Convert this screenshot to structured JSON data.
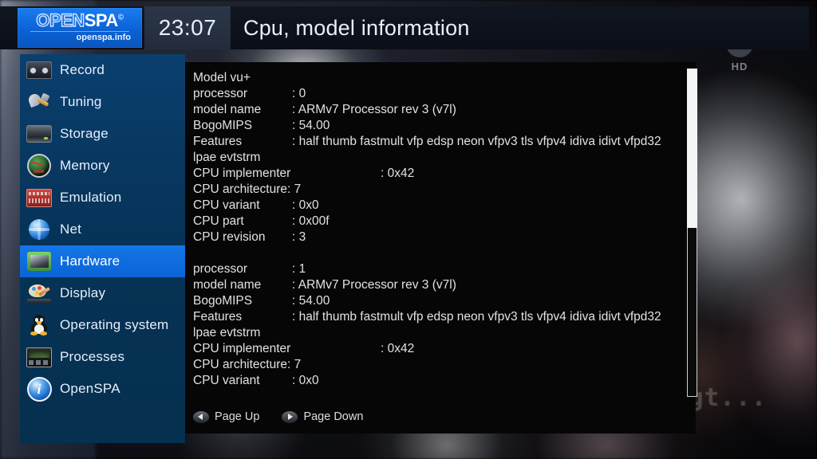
{
  "header": {
    "logo": {
      "part1": "OPEN",
      "part2": "SPA",
      "copyright": "©",
      "subtitle": "openspa.info"
    },
    "clock": "23:07",
    "title": "Cpu, model information"
  },
  "channel_logo": {
    "icon": "play-circle-icon",
    "label": "HD"
  },
  "background": {
    "overlay_text": "Fortsetzung folgt..."
  },
  "sidebar": {
    "items": [
      {
        "label": "Record",
        "icon": "record-tape-icon",
        "selected": false
      },
      {
        "label": "Tuning",
        "icon": "satellite-dish-icon",
        "selected": false
      },
      {
        "label": "Storage",
        "icon": "hard-disk-icon",
        "selected": false
      },
      {
        "label": "Memory",
        "icon": "ram-gauge-icon",
        "selected": false
      },
      {
        "label": "Emulation",
        "icon": "emulation-card-icon",
        "selected": false
      },
      {
        "label": "Net",
        "icon": "globe-network-icon",
        "selected": false
      },
      {
        "label": "Hardware",
        "icon": "cpu-chip-icon",
        "selected": true
      },
      {
        "label": "Display",
        "icon": "palette-brush-icon",
        "selected": false
      },
      {
        "label": "Operating system",
        "icon": "tux-penguin-icon",
        "selected": false
      },
      {
        "label": "Processes",
        "icon": "processes-monitor-icon",
        "selected": false
      },
      {
        "label": "OpenSPA",
        "icon": "info-circle-icon",
        "selected": false
      }
    ]
  },
  "content": {
    "lines": [
      {
        "type": "single",
        "key": "Model vu+"
      },
      {
        "type": "pair",
        "key": "processor",
        "value": ": 0"
      },
      {
        "type": "pair",
        "key": "model name",
        "value": ": ARMv7 Processor rev 3 (v7l)"
      },
      {
        "type": "pair",
        "key": "BogoMIPS",
        "value": ": 54.00"
      },
      {
        "type": "pair",
        "key": "Features",
        "value": ": half thumb fastmult vfp edsp neon vfpv3 tls vfpv4 idiva idivt vfpd32"
      },
      {
        "type": "single",
        "key": "lpae evtstrm"
      },
      {
        "type": "pair-far",
        "key": "CPU implementer",
        "value": ": 0x42"
      },
      {
        "type": "single",
        "key": "CPU architecture: 7"
      },
      {
        "type": "pair",
        "key": "CPU variant",
        "value": ": 0x0"
      },
      {
        "type": "pair",
        "key": "CPU part",
        "value": ": 0x00f"
      },
      {
        "type": "pair",
        "key": "CPU revision",
        "value": ": 3"
      },
      {
        "type": "gap",
        "key": ""
      },
      {
        "type": "pair",
        "key": "processor",
        "value": ": 1"
      },
      {
        "type": "pair",
        "key": "model name",
        "value": ": ARMv7 Processor rev 3 (v7l)"
      },
      {
        "type": "pair",
        "key": "BogoMIPS",
        "value": ": 54.00"
      },
      {
        "type": "pair",
        "key": "Features",
        "value": ": half thumb fastmult vfp edsp neon vfpv3 tls vfpv4 idiva idivt vfpd32"
      },
      {
        "type": "single",
        "key": "lpae evtstrm"
      },
      {
        "type": "pair-far",
        "key": "CPU implementer",
        "value": ": 0x42"
      },
      {
        "type": "single",
        "key": "CPU architecture: 7"
      },
      {
        "type": "pair",
        "key": "CPU variant",
        "value": ": 0x0"
      }
    ]
  },
  "footer": {
    "page_up": {
      "label": "Page Up",
      "icon": "chevron-left-icon"
    },
    "page_down": {
      "label": "Page Down",
      "icon": "chevron-right-icon"
    }
  },
  "colors": {
    "accent_blue": "#0b62d6",
    "sidebar_blue": "#063256",
    "selected_blue": "#0a64d6",
    "panel_black": "#060606",
    "text_light": "#dfe2e6"
  }
}
